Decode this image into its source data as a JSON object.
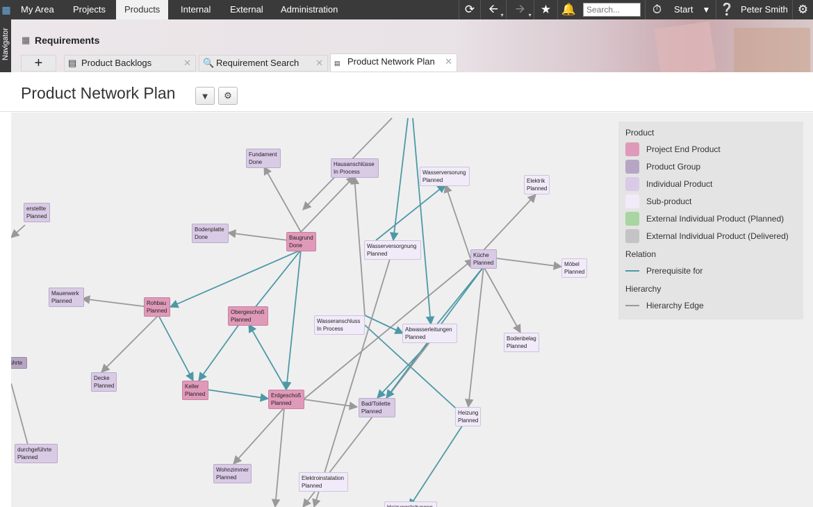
{
  "topbar": {
    "tabs": [
      {
        "label": "My Area"
      },
      {
        "label": "Projects"
      },
      {
        "label": "Products"
      },
      {
        "label": "Internal"
      },
      {
        "label": "External"
      },
      {
        "label": "Administration"
      }
    ],
    "search_placeholder": "Search...",
    "start_label": "Start",
    "user_name": "Peter Smith"
  },
  "navigator_label": "Navigator",
  "section_title": "Requirements",
  "tabs": [
    {
      "label": "Product Backlogs"
    },
    {
      "label": "Requirement Search"
    },
    {
      "label": "Product Network Plan"
    }
  ],
  "page_title": "Product Network Plan",
  "graph": {
    "nodes": [
      {
        "name": "Fundament",
        "status": "Done",
        "type": "indiv"
      },
      {
        "name": "Hausanschlüsse",
        "status": "In Process",
        "type": "indiv"
      },
      {
        "name": "Wasserversorung",
        "status": "Planned",
        "type": "sub"
      },
      {
        "name": "Elektrik",
        "status": "Planned",
        "type": "sub"
      },
      {
        "name": "erstellte",
        "status": "Planned",
        "type": "indiv"
      },
      {
        "name": "Bodenplatte",
        "status": "Done",
        "type": "indiv"
      },
      {
        "name": "Baugrund",
        "status": "Done",
        "type": "end"
      },
      {
        "name": "Wasserversorgnung",
        "status": "Planned",
        "type": "sub"
      },
      {
        "name": "Küche",
        "status": "Planned",
        "type": "indiv"
      },
      {
        "name": "Möbel",
        "status": "Planned",
        "type": "sub"
      },
      {
        "name": "Mauerwerk",
        "status": "Planned",
        "type": "indiv"
      },
      {
        "name": "Rohbau",
        "status": "Planned",
        "type": "end"
      },
      {
        "name": "Obergeschoß",
        "status": "Planned",
        "type": "end"
      },
      {
        "name": "Wasseranschluss",
        "status": "In Process",
        "type": "sub"
      },
      {
        "name": "Abwasserleitungen",
        "status": "Planned",
        "type": "sub"
      },
      {
        "name": "Bodenbelag",
        "status": "Planned",
        "type": "sub"
      },
      {
        "name": "ührte",
        "status": "",
        "type": "group"
      },
      {
        "name": "Decke",
        "status": "Planned",
        "type": "indiv"
      },
      {
        "name": "Keller",
        "status": "Planned",
        "type": "end"
      },
      {
        "name": "Erdgeschoß",
        "status": "Planned",
        "type": "end"
      },
      {
        "name": "Bad/Toilette",
        "status": "Planned",
        "type": "indiv"
      },
      {
        "name": "Heizung",
        "status": "Planned",
        "type": "sub"
      },
      {
        "name": "durchgeführte",
        "status": "Planned",
        "type": "indiv"
      },
      {
        "name": "Wohnzimmer",
        "status": "Planned",
        "type": "indiv"
      },
      {
        "name": "Elektroinstalation",
        "status": "Planned",
        "type": "sub"
      },
      {
        "name": "Heizungsleitungen",
        "status": "",
        "type": "sub"
      }
    ]
  },
  "legend": {
    "product_heading": "Product",
    "items": [
      {
        "label": "Project End Product",
        "color": "#e09ab9"
      },
      {
        "label": "Product Group",
        "color": "#b6a6c4"
      },
      {
        "label": "Individual Product",
        "color": "#d9cbe6"
      },
      {
        "label": "Sub-product",
        "color": "#f1ebf9"
      },
      {
        "label": "External Individual Product (Planned)",
        "color": "#a8d5a0"
      },
      {
        "label": "External Individual Product (Delivered)",
        "color": "#c4c4c4"
      }
    ],
    "relation_heading": "Relation",
    "relation_label": "Prerequisite for",
    "relation_color": "#4e98a6",
    "hierarchy_heading": "Hierarchy",
    "hierarchy_label": "Hierarchy Edge",
    "hierarchy_color": "#999999"
  }
}
